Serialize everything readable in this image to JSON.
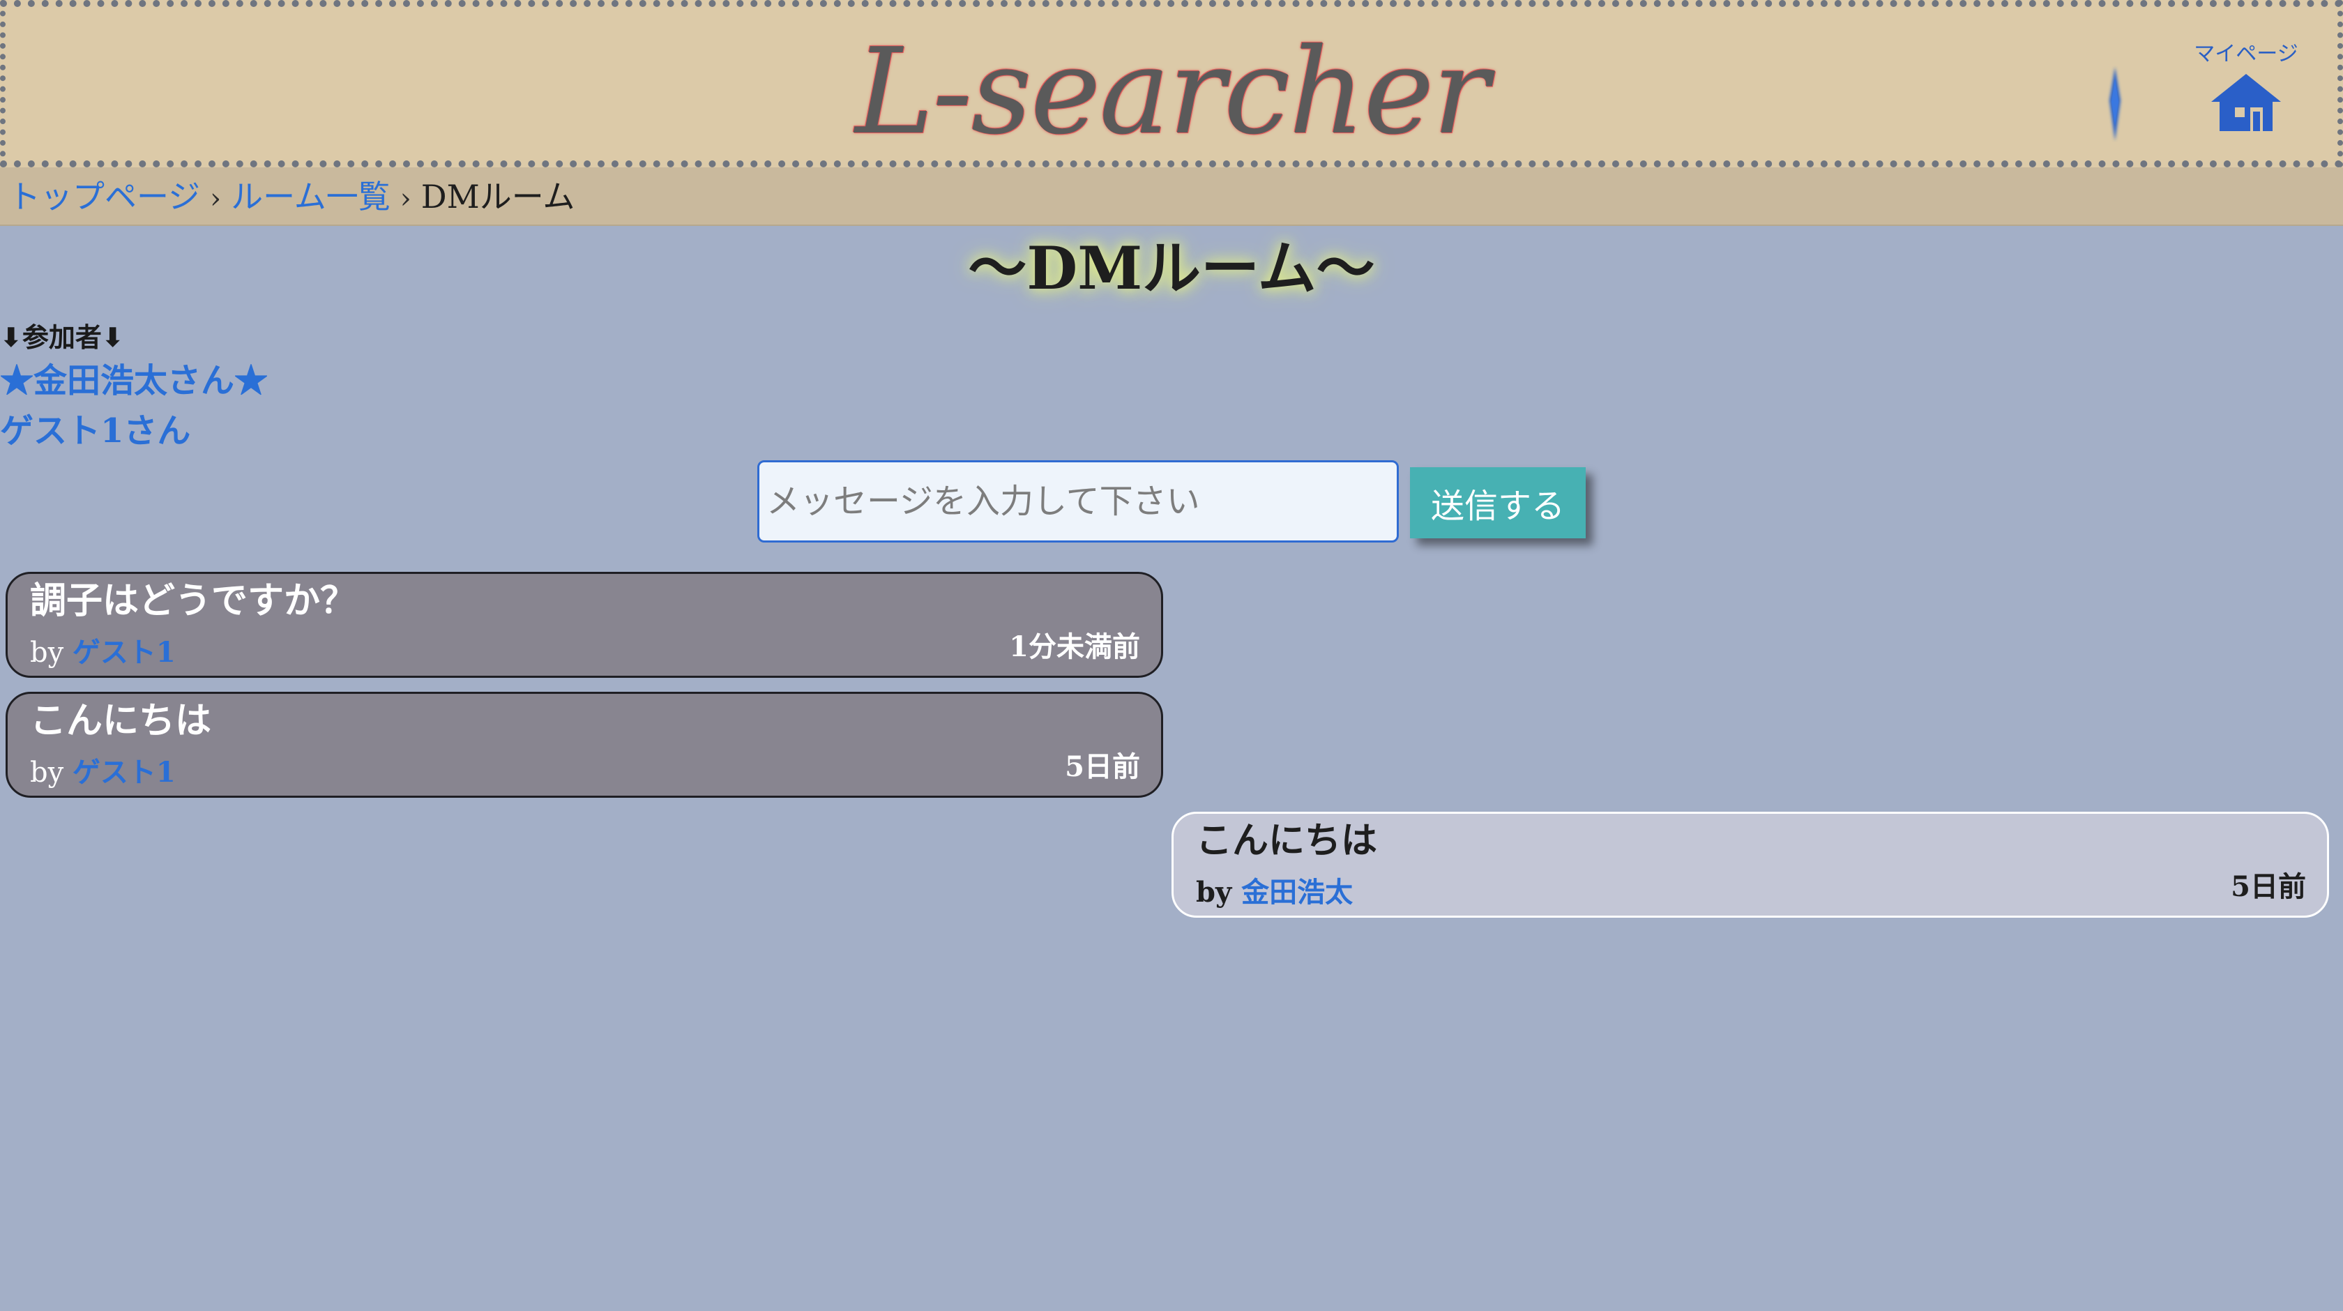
{
  "header": {
    "site_title": "L-searcher",
    "mypage_label": "マイページ"
  },
  "breadcrumb": {
    "items": [
      {
        "label": "トップページ",
        "link": true
      },
      {
        "label": "ルーム一覧",
        "link": true
      },
      {
        "label": "DMルーム",
        "link": false
      }
    ],
    "separator": "›"
  },
  "page_title": "〜DMルーム〜",
  "participants": {
    "heading": "⬇参加者⬇",
    "list": [
      "★金田浩太さん★",
      "ゲスト1さん"
    ]
  },
  "form": {
    "placeholder": "メッセージを入力して下さい",
    "value": "",
    "send_label": "送信する"
  },
  "messages": [
    {
      "text": "調子はどうですか？",
      "by_prefix": "by",
      "author": "ゲスト1",
      "time": "1分未満前",
      "side": "other"
    },
    {
      "text": "こんにちは",
      "by_prefix": "by",
      "author": "ゲスト1",
      "time": "5日前",
      "side": "other"
    },
    {
      "text": "こんにちは",
      "by_prefix": "by",
      "author": "金田浩太",
      "time": "5日前",
      "side": "mine"
    }
  ],
  "colors": {
    "background": "#a3afc7",
    "header_bg": "#dccaa8",
    "breadcrumb_bg": "#c9b99d",
    "link": "#2a6fd6",
    "send_button": "#47b1b3",
    "bubble_other": "#888590",
    "bubble_mine": "#c3c6d6"
  },
  "icons": [
    "lighthouse-icon",
    "home-icon"
  ]
}
